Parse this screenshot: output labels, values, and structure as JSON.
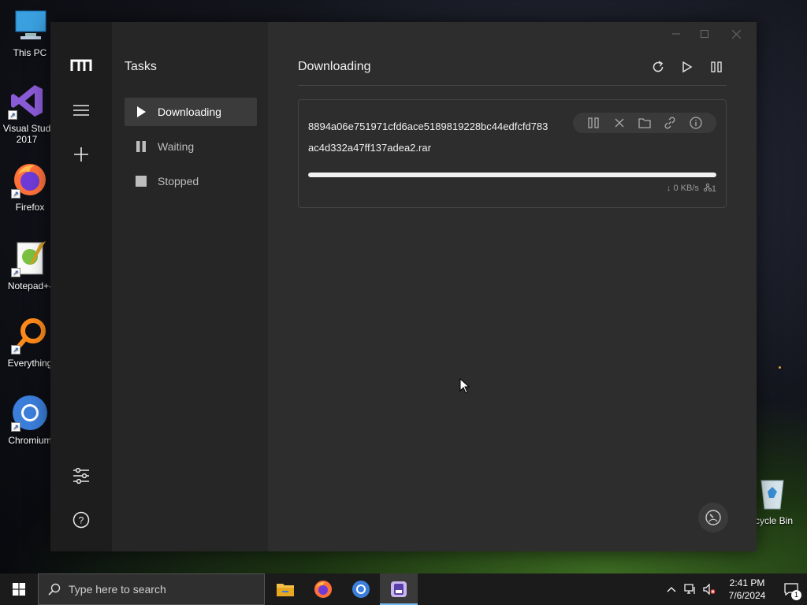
{
  "desktop": {
    "icons": [
      {
        "label": "This PC"
      },
      {
        "label": "Visual Stud 2017"
      },
      {
        "label": "Firefox"
      },
      {
        "label": "Notepad+-"
      },
      {
        "label": "Everything"
      },
      {
        "label": "Chromium"
      },
      {
        "label": "cycle Bin"
      }
    ]
  },
  "app": {
    "sidebar": {
      "title": "Tasks",
      "items": [
        {
          "label": "Downloading"
        },
        {
          "label": "Waiting"
        },
        {
          "label": "Stopped"
        }
      ]
    },
    "main": {
      "title": "Downloading",
      "task": {
        "name_line1": "8894a06e751971cfd6ace5189819228bc44edfcfd783",
        "name_line2": "ac4d332a47ff137adea2.rar",
        "progress": 1.0,
        "speed": "↓ 0 KB/s",
        "connections": "1"
      }
    }
  },
  "taskbar": {
    "search_placeholder": "Type here to search",
    "time": "2:41 PM",
    "date": "7/6/2024",
    "notification_count": "1"
  },
  "colors": {
    "accent": "#76b9ed",
    "window_bg": "#2d2d2d",
    "rail_bg": "#1d1d1d"
  }
}
